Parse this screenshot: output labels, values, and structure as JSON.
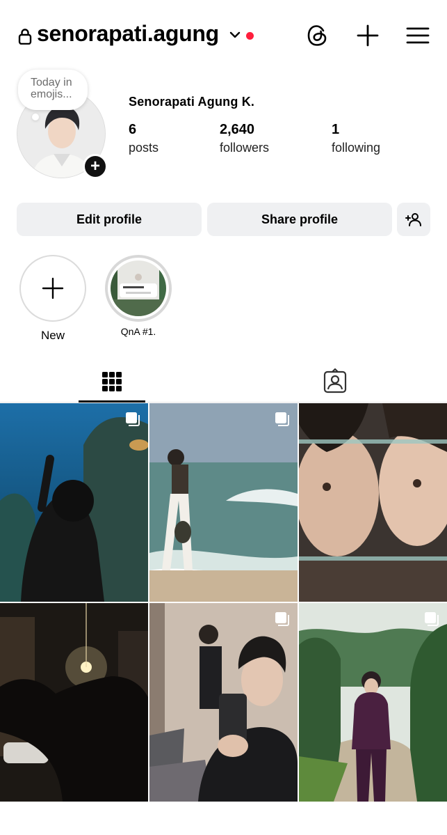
{
  "header": {
    "username": "senorapati.agung",
    "icons": [
      "lock-icon",
      "chevron-down-icon",
      "threads-icon",
      "plus-icon",
      "menu-icon"
    ],
    "notification_dot_color": "#ff1f3d"
  },
  "profile": {
    "note": "Today in emojis...",
    "full_name": "Senorapati Agung K.",
    "stats": {
      "posts_count": "6",
      "posts_label": "posts",
      "followers_count": "2,640",
      "followers_label": "followers",
      "following_count": "1",
      "following_label": "following"
    }
  },
  "actions": {
    "edit_label": "Edit profile",
    "share_label": "Share profile"
  },
  "highlights": [
    {
      "label": "New"
    },
    {
      "label": "QnA #1."
    }
  ],
  "tabs": [
    {
      "icon": "grid-icon",
      "active": true
    },
    {
      "icon": "tagged-icon",
      "active": false
    }
  ],
  "posts": [
    {
      "id": "aquarium",
      "multiple": true
    },
    {
      "id": "beach",
      "multiple": true
    },
    {
      "id": "mirror-closeup",
      "multiple": false
    },
    {
      "id": "night-street",
      "multiple": false
    },
    {
      "id": "mirror-selfie",
      "multiple": true
    },
    {
      "id": "forest-suit",
      "multiple": true
    }
  ]
}
